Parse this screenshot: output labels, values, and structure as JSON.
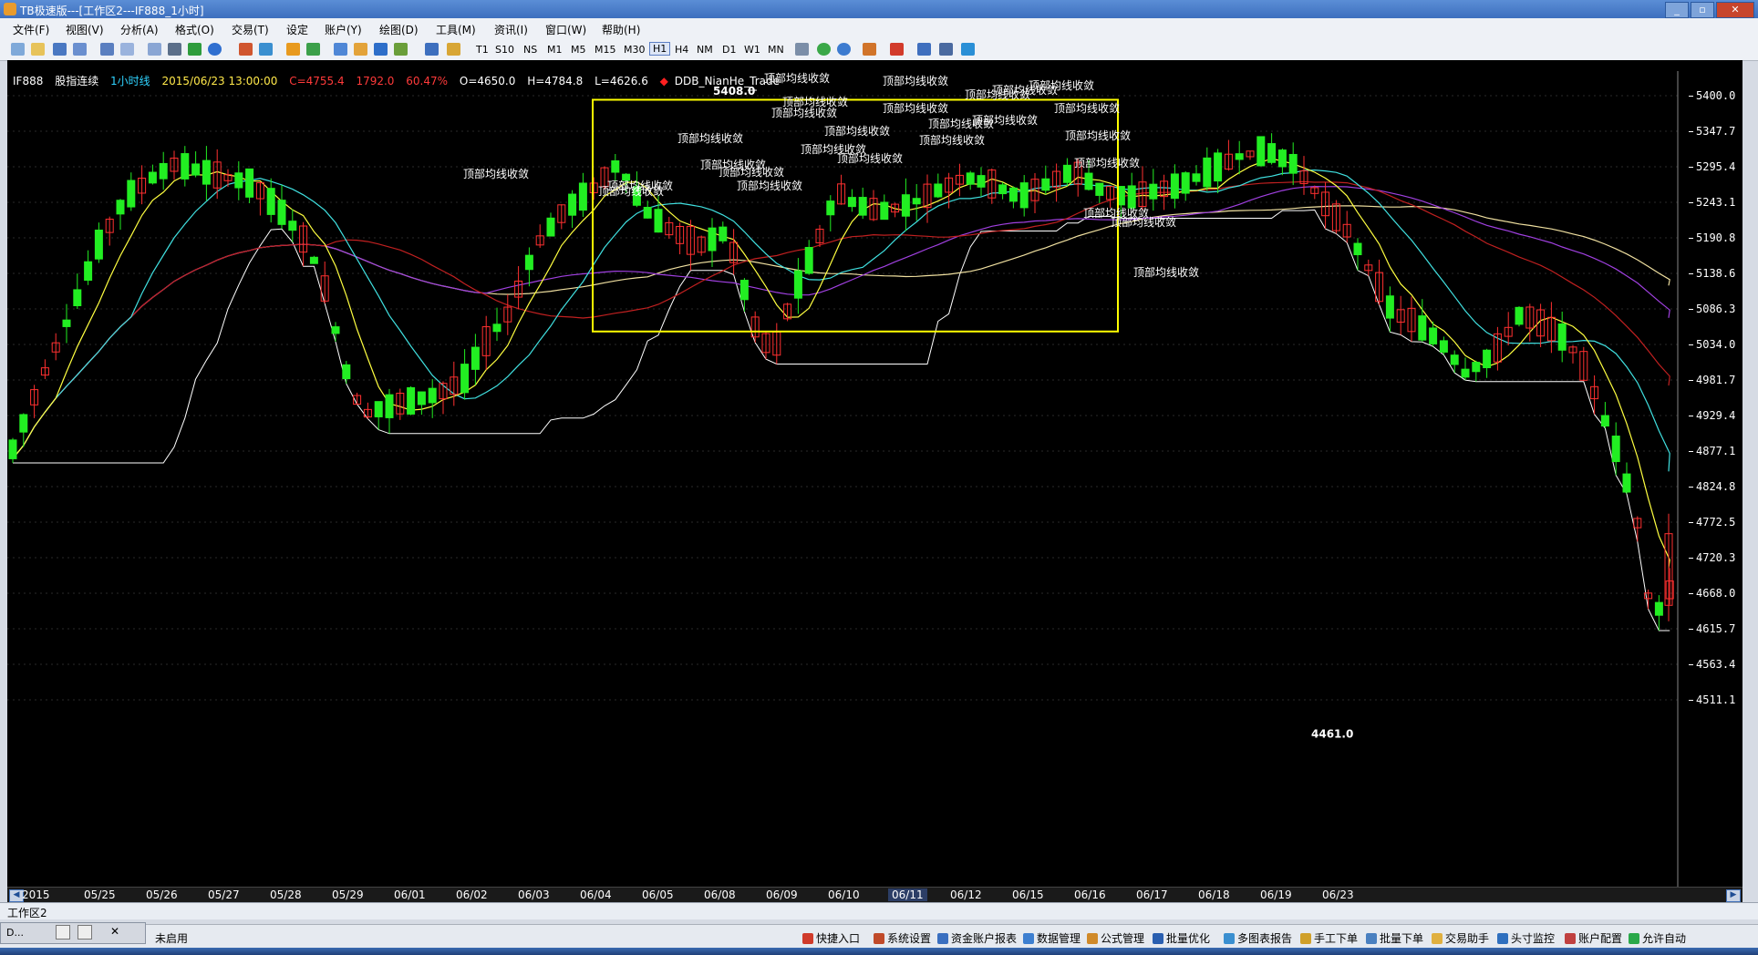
{
  "window": {
    "title": "TB极速版---[工作区2---IF888_1小时]",
    "buttons": [
      "_",
      "▫",
      "✕"
    ]
  },
  "menu": [
    "文件(F)",
    "视图(V)",
    "分析(A)",
    "格式(O)",
    "交易(T)",
    "设定",
    "账户(Y)",
    "绘图(D)",
    "工具(M)",
    "资讯(I)",
    "窗口(W)",
    "帮助(H)"
  ],
  "periods": [
    "T1",
    "S10",
    "NS",
    "M1",
    "M5",
    "M15",
    "M30",
    "H1",
    "H4",
    "NM",
    "D1",
    "W1",
    "MN"
  ],
  "active_period": "H1",
  "info": {
    "symbol": "IF888",
    "name": "股指连续",
    "period": "1小时线",
    "datetime": "2015/06/23 13:00:00",
    "close": "C=4755.4",
    "change": "1792.0",
    "pct": "60.47%",
    "open": "O=4650.0",
    "high": "H=4784.8",
    "low": "L=4626.6",
    "indicator_marker": "◆",
    "indicator": "DDB_NianHe_Trade"
  },
  "annotations": {
    "high_label": "5408.0",
    "low_label": "4461.0",
    "signal_text": "顶部均线收敛"
  },
  "colors": {
    "background": "#000000",
    "up_candle": "#ff3030",
    "down_candle": "#22ee22",
    "ma_fast": "#ffff40",
    "ma_mid": "#40e0e0",
    "ma_slow": "#a040e0",
    "ma_red": "#c02020",
    "ma_long": "#f0e0a0",
    "box": "#ffff00",
    "channel": "#ffffff"
  },
  "chart_data": {
    "type": "candlestick",
    "title": "IF888 股指连续 1小时线",
    "ylim": [
      4461.0,
      5408.0
    ],
    "y_ticks": [
      "5400.0",
      "5347.7",
      "5295.4",
      "5243.1",
      "5190.8",
      "5138.6",
      "5086.3",
      "5034.0",
      "4981.7",
      "4929.4",
      "4877.1",
      "4824.8",
      "4772.5",
      "4720.3",
      "4668.0",
      "4615.7",
      "4563.4",
      "4511.1"
    ],
    "x_labels": [
      "2015",
      "05/25",
      "05/26",
      "05/27",
      "05/28",
      "05/29",
      "06/01",
      "06/02",
      "06/03",
      "06/04",
      "06/05",
      "06/08",
      "06/09",
      "06/10",
      "06/11",
      "06/12",
      "06/15",
      "06/16",
      "06/17",
      "06/18",
      "06/19",
      "06/23"
    ],
    "highlighted_label": "06/11",
    "last": {
      "open": 4650.0,
      "high": 4784.8,
      "low": 4626.6,
      "close": 4755.4
    }
  },
  "workspace_tab": "工作区2",
  "status": {
    "left_text": "未启用",
    "mini_label": "D...",
    "items": [
      "快捷入口",
      "系统设置",
      "资金账户报表",
      "数据管理",
      "公式管理",
      "批量优化",
      "多图表报告",
      "手工下单",
      "批量下单",
      "交易助手",
      "头寸监控",
      "账户配置",
      "允许自动"
    ]
  }
}
